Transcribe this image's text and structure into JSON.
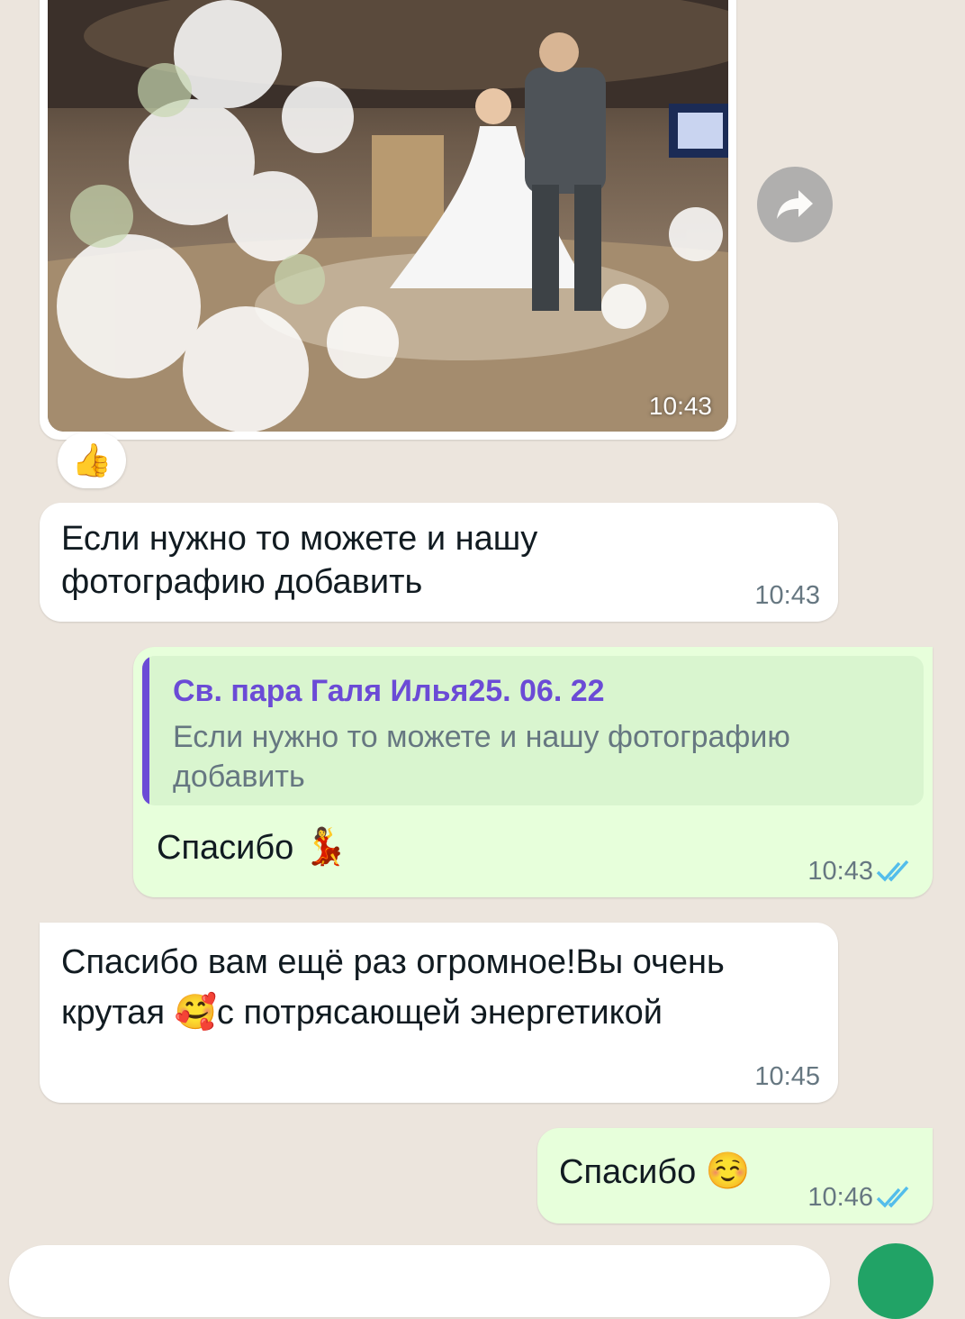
{
  "photo_message": {
    "time": "10:43"
  },
  "reaction": {
    "emoji": "👍"
  },
  "messages": [
    {
      "text_lines": [
        "Если нужно то можете и нашу",
        "фотографию добавить"
      ],
      "time": "10:43"
    },
    {
      "quote_author": "Св. пара Галя Илья25. 06. 22",
      "quote_lines": [
        "Если нужно то можете и нашу фотографию",
        "добавить"
      ],
      "text": "Спасибо",
      "emoji": "💃",
      "time": "10:43"
    },
    {
      "text_lines": [
        "Спасибо вам ещё раз огромное!Вы очень",
        "крутая"
      ],
      "emoji": "🥰",
      "text_after": "с потрясающей энергетикой",
      "time": "10:45"
    },
    {
      "text": "Спасибо",
      "emoji": "☺️",
      "time": "10:46"
    }
  ],
  "icons": {
    "forward": "forward-arrow-icon",
    "read_receipt": "double-check-icon"
  },
  "colors": {
    "background": "#ece5dd",
    "outgoing": "#e7ffdb",
    "incoming": "#ffffff",
    "quote_accent": "#6b4bd6",
    "ticks": "#53bdeb",
    "send": "#21a366"
  }
}
